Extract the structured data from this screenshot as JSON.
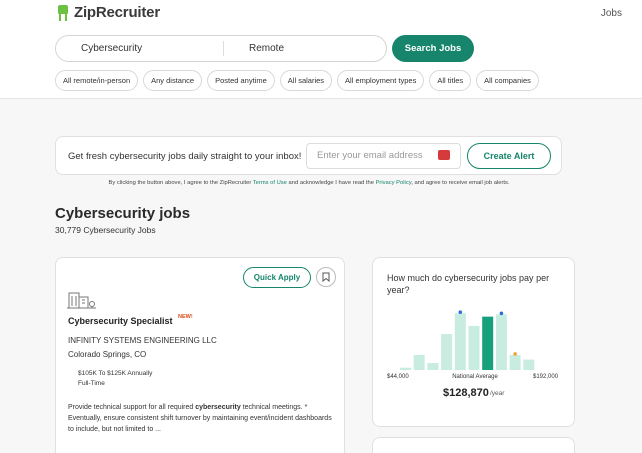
{
  "header": {
    "logo_text": "ZipRecruiter",
    "nav_jobs": "Jobs",
    "colors": {
      "brand_green": "#6ec042",
      "accent": "#16856b"
    }
  },
  "search": {
    "keyword": "Cybersecurity",
    "location": "Remote",
    "button_label": "Search Jobs"
  },
  "filters": [
    "All remote/in-person",
    "Any distance",
    "Posted anytime",
    "All salaries",
    "All employment types",
    "All titles",
    "All companies"
  ],
  "alert": {
    "text": "Get fresh cybersecurity jobs daily straight to your inbox!",
    "email_placeholder": "Enter your email address",
    "button_label": "Create Alert",
    "consent_prefix": "By clicking the button above, I agree to the ZipRecruiter ",
    "terms_link": "Terms of Use",
    "consent_mid": " and acknowledge I have read the ",
    "privacy_link": "Privacy Policy",
    "consent_suffix": ", and agree to receive email job alerts."
  },
  "results": {
    "title": "Cybersecurity jobs",
    "count": "30,779 Cybersecurity Jobs"
  },
  "job": {
    "quick_apply": "Quick Apply",
    "title": "Cybersecurity Specialist",
    "badge": "NEW!",
    "company": "INFINITY SYSTEMS ENGINEERING LLC",
    "location": "Colorado Springs, CO",
    "salary": "$105K To $125K Annually",
    "type": "Full-Time",
    "snippet_pre": "Provide technical support for all required ",
    "snippet_bold": "cybersecurity",
    "snippet_post": " technical meetings. * Eventually, ensure consistent shift turnover by maintaining event/incident dashboards to include, but not limited to ..."
  },
  "salary_widget": {
    "question": "How much do cybersecurity jobs pay per year?",
    "min_label": "$44,000",
    "mid_label": "National Average",
    "max_label": "$192,000",
    "average": "$128,870",
    "unit": "/year",
    "bar_levels": [
      0.04,
      0.26,
      0.12,
      0.62,
      0.98,
      0.76,
      0.92,
      0.96,
      0.26,
      0.18
    ],
    "highlight_index": 6,
    "dot_indices_blue": [
      4,
      7
    ],
    "dot_indices_orange": [
      8
    ],
    "colors": {
      "bar": "#c9ece0",
      "bar_highlight": "#16a07c",
      "dot_blue": "#2a6fd6",
      "dot_orange": "#f0a030"
    }
  }
}
